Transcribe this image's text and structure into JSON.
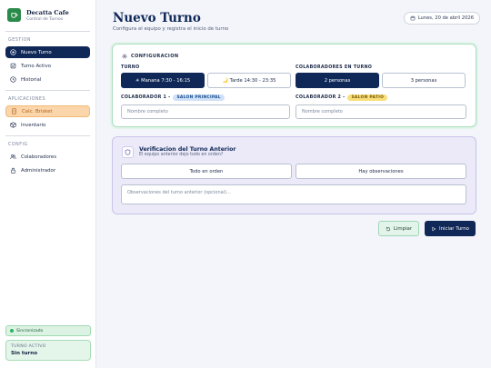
{
  "brand": {
    "name": "Decatta Cafe",
    "subtitle": "Control de Turnos"
  },
  "sidebar": {
    "sections": [
      {
        "label": "GESTION",
        "items": [
          {
            "label": "Nuevo Turno",
            "icon": "plus-circle-icon",
            "active": true
          },
          {
            "label": "Turno Activo",
            "icon": "check-square-icon"
          },
          {
            "label": "Historial",
            "icon": "clock-icon"
          }
        ]
      },
      {
        "label": "APLICACIONES",
        "items": [
          {
            "label": "Calc. Brisket",
            "icon": "calculator-icon",
            "highlighted": true
          },
          {
            "label": "Inventario",
            "icon": "box-icon"
          }
        ]
      },
      {
        "label": "CONFIG",
        "items": [
          {
            "label": "Colaboradores",
            "icon": "users-icon"
          },
          {
            "label": "Administrador",
            "icon": "lock-icon"
          }
        ]
      }
    ],
    "sync_status": "Sincronizado",
    "active_shift": {
      "label": "TURNO ACTIVO",
      "value": "Sin turno"
    }
  },
  "header": {
    "title": "Nuevo Turno",
    "subtitle": "Configura el equipo y registra el inicio de turno",
    "date": "Lunes, 20 de abril 2026"
  },
  "config": {
    "heading": "CONFIGURACION",
    "turno_label": "TURNO",
    "turno_options": [
      "☀ Manana 7:30 - 16:15",
      "🌙 Tarde 14:30 - 23:35"
    ],
    "colab_label": "COLABORADORES EN TURNO",
    "colab_options": [
      "2 personas",
      "3 personas"
    ],
    "colab1": {
      "label": "COLABORADOR 1 -",
      "tag": "SALON PRINCIPAL",
      "placeholder": "Nombre completo"
    },
    "colab2": {
      "label": "COLABORADOR 2 -",
      "tag": "SALON PATIO",
      "placeholder": "Nombre completo"
    }
  },
  "verify": {
    "title": "Verificacion del Turno Anterior",
    "subtitle": "El equipo anterior dejo todo en orden?",
    "option_ok": "Todo en orden",
    "option_obs": "Hay observaciones",
    "placeholder": "Observaciones del turno anterior (opcional)..."
  },
  "actions": {
    "clear": "Limpiar",
    "start": "Iniciar Turno"
  },
  "colors": {
    "navy": "#0f2857",
    "accent_green": "#2eb360",
    "warm": "#fbd6ab"
  }
}
